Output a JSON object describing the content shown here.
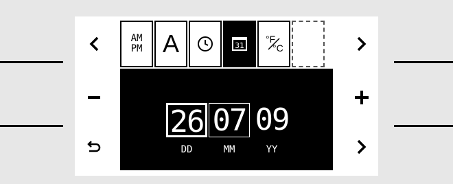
{
  "nav": {
    "left_prev": "‹",
    "minus": "−",
    "back_icon": "undo-arrow-icon",
    "right_next_top": "›",
    "plus": "+",
    "right_next_bottom": "›"
  },
  "tiles": [
    {
      "name": "ampm-tile",
      "label_top": "AM",
      "label_bottom": "PM"
    },
    {
      "name": "font-tile",
      "label": "A"
    },
    {
      "name": "clock-tile",
      "icon": "clock-icon"
    },
    {
      "name": "date-tile",
      "label": "31",
      "selected": true
    },
    {
      "name": "temperature-unit-tile",
      "label_f": "°F",
      "label_c": "°C"
    },
    {
      "name": "empty-tile"
    }
  ],
  "date": {
    "day": "26",
    "month": "07",
    "year": "09",
    "labels": {
      "day": "DD",
      "month": "MM",
      "year": "YY"
    }
  },
  "colors": {
    "background": "#e7e7e7",
    "panel": "#ffffff",
    "screen": "#000000",
    "text_on_screen": "#ffffff"
  }
}
